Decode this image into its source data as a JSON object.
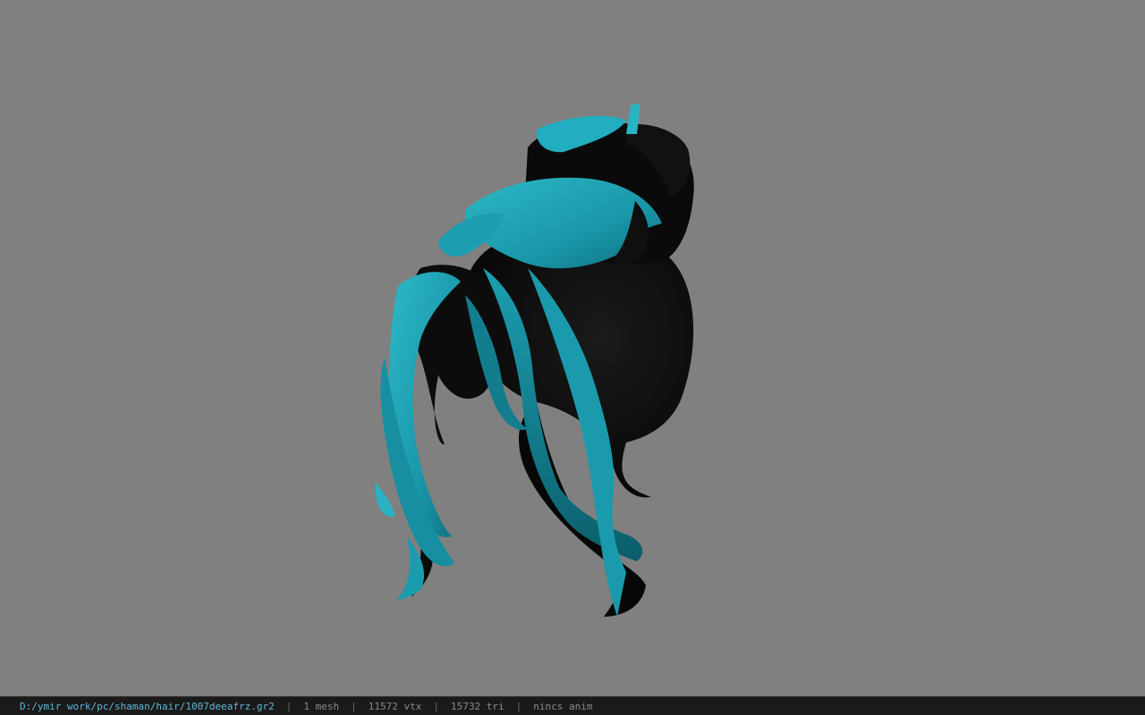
{
  "viewer": {
    "background_color": "#808080",
    "model": {
      "subject": "hair mesh",
      "primary_color": "#0a0a0a",
      "accent_color": "#1fa6b8"
    }
  },
  "status_bar": {
    "file_path": "D:/ymir work/pc/shaman/hair/1007deeafrz.gr2",
    "separator": "|",
    "mesh_count": "1 mesh",
    "vertex_count": "11572 vtx",
    "triangle_count": "15732 tri",
    "animation": "nincs anim"
  }
}
